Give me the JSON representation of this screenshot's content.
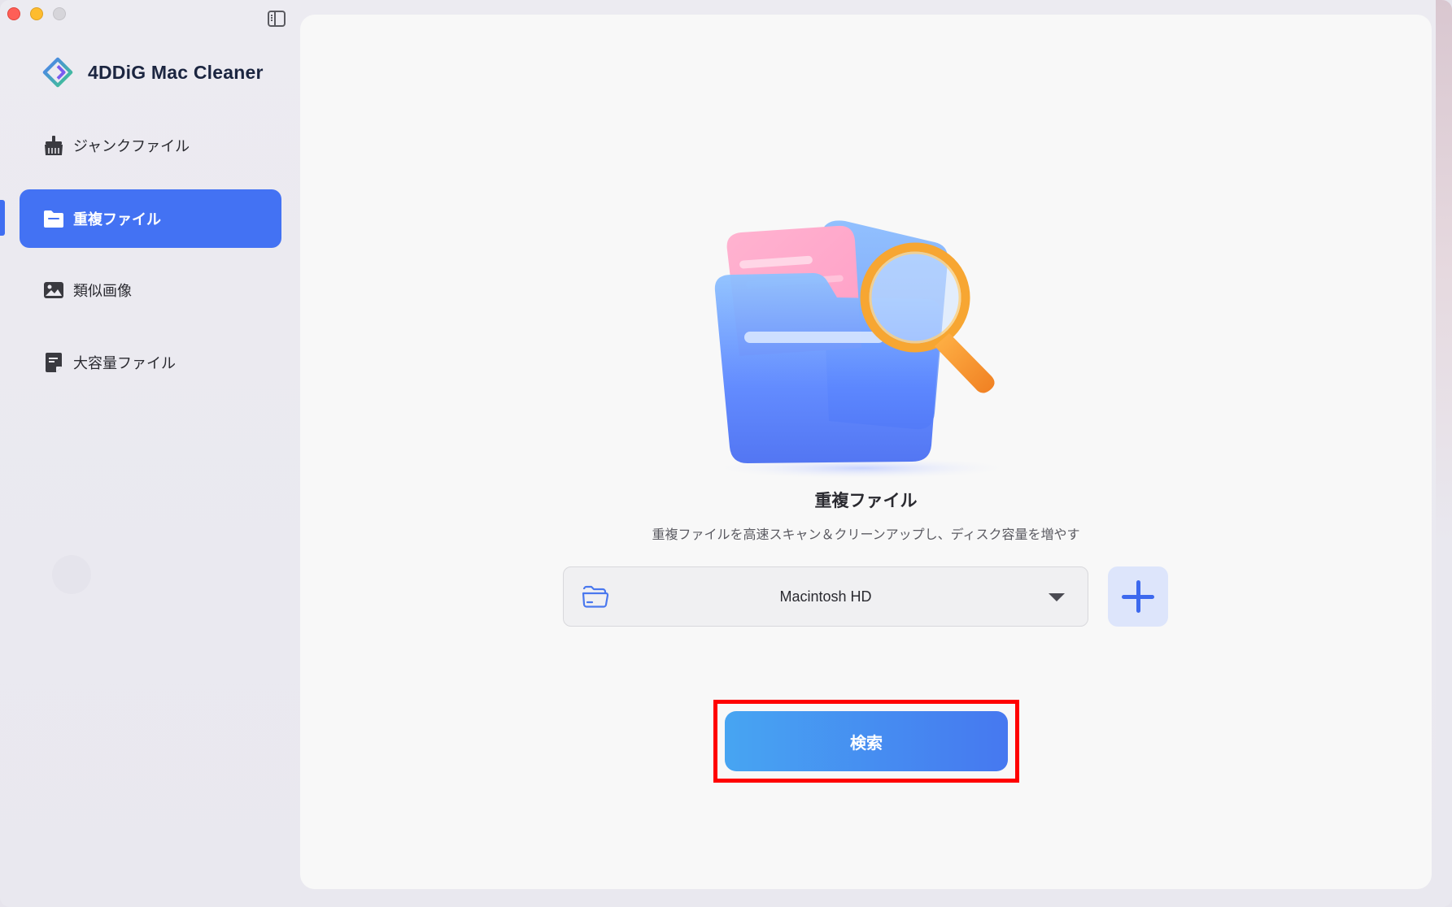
{
  "app": {
    "name": "4DDiG Mac Cleaner",
    "accent_color": "#4372f3"
  },
  "window_controls": {
    "close_icon": "close-circle-red",
    "minimize_icon": "minimize-circle-yellow",
    "zoom_icon": "zoom-circle-gray",
    "sidebar_toggle_icon": "sidebar-toggle-icon"
  },
  "sidebar": {
    "items": [
      {
        "label": "ジャンクファイル",
        "icon": "broom-icon",
        "active": false
      },
      {
        "label": "重複ファイル",
        "icon": "folder-icon",
        "active": true
      },
      {
        "label": "類似画像",
        "icon": "image-icon",
        "active": false
      },
      {
        "label": "大容量ファイル",
        "icon": "large-file-icon",
        "active": false
      }
    ]
  },
  "main": {
    "illustration": "folder-with-magnifier-illustration",
    "title": "重複ファイル",
    "subtitle": "重複ファイルを高速スキャン＆クリーンアップし、ディスク容量を増やす",
    "location_select": {
      "value": "Macintosh HD",
      "icon": "folder-outline-icon"
    },
    "add_button_icon": "plus-icon",
    "search_button": {
      "label": "検索",
      "highlight_color": "#ff0000"
    }
  }
}
